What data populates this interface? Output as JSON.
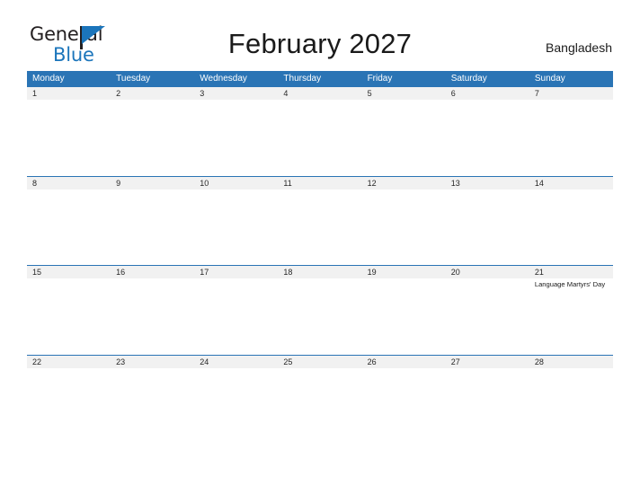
{
  "brand": {
    "line1": "General",
    "line2": "Blue",
    "triangle_color": "#1b75bb",
    "text_color": "#231f20"
  },
  "header": {
    "title": "February 2027",
    "country": "Bangladesh"
  },
  "theme": {
    "header_blue": "#2a74b5",
    "row_line_blue": "#2a74b5",
    "date_band_gray": "#f1f1f1",
    "page_background": "#ffffff",
    "text_color": "#1a1a1a"
  },
  "calendar": {
    "weekday_headers": [
      "Monday",
      "Tuesday",
      "Wednesday",
      "Thursday",
      "Friday",
      "Saturday",
      "Sunday"
    ],
    "weeks": [
      {
        "days": [
          {
            "date": "1",
            "events": []
          },
          {
            "date": "2",
            "events": []
          },
          {
            "date": "3",
            "events": []
          },
          {
            "date": "4",
            "events": []
          },
          {
            "date": "5",
            "events": []
          },
          {
            "date": "6",
            "events": []
          },
          {
            "date": "7",
            "events": []
          }
        ]
      },
      {
        "days": [
          {
            "date": "8",
            "events": []
          },
          {
            "date": "9",
            "events": []
          },
          {
            "date": "10",
            "events": []
          },
          {
            "date": "11",
            "events": []
          },
          {
            "date": "12",
            "events": []
          },
          {
            "date": "13",
            "events": []
          },
          {
            "date": "14",
            "events": []
          }
        ]
      },
      {
        "days": [
          {
            "date": "15",
            "events": []
          },
          {
            "date": "16",
            "events": []
          },
          {
            "date": "17",
            "events": []
          },
          {
            "date": "18",
            "events": []
          },
          {
            "date": "19",
            "events": []
          },
          {
            "date": "20",
            "events": []
          },
          {
            "date": "21",
            "events": [
              "Language Martyrs' Day"
            ]
          }
        ]
      },
      {
        "days": [
          {
            "date": "22",
            "events": []
          },
          {
            "date": "23",
            "events": []
          },
          {
            "date": "24",
            "events": []
          },
          {
            "date": "25",
            "events": []
          },
          {
            "date": "26",
            "events": []
          },
          {
            "date": "27",
            "events": []
          },
          {
            "date": "28",
            "events": []
          }
        ]
      }
    ]
  }
}
